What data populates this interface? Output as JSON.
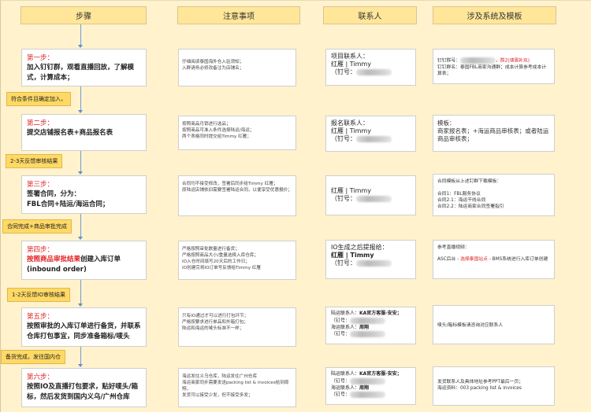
{
  "headers": {
    "steps": "步骤",
    "notes": "注意事项",
    "contacts": "联系人",
    "systems": "涉及系统及模板"
  },
  "transitions": [
    "符合条件且确定加入，",
    "2-3天反馈审核结果",
    "合同完成+商品审批完成",
    "1-2天反馈IO审核结果",
    "备货完成，发往国内仓"
  ],
  "steps": [
    {
      "title": "第一步：",
      "body": "加入钉钉群，观看直播回放，了解模式，计算成本；"
    },
    {
      "title": "第二步：",
      "body": "提交店铺报名表+商品报名表"
    },
    {
      "title": "第三步：",
      "body": "签署合同，分为：",
      "body2": "FBL合同+陆运/海运合同；"
    },
    {
      "title": "第四步：",
      "body_red": "按照商品审批结果",
      "body": "创建入库订单",
      "body2": "(inbound order)"
    },
    {
      "title": "第五步：",
      "body": "按照审批的入库订单进行备货，并联系仓库打包事宜，同步准备箱标/唛头"
    },
    {
      "title": "第六步：",
      "body": "按照IO及直播打包要求，贴好唛头/箱标，然后发货到国内义乌/广州仓库"
    }
  ],
  "notes": [
    [
      "仔细阅读泰国海外仓入驻须知；",
      "入群请务必修改备注为店铺名；"
    ],
    [
      "按照商品月销进行选品；",
      "按照商品可准入条件选择陆运/海运；",
      "两个表格同时提交给Timmy 红雁；"
    ],
    [
      "合同均不接受修改，签署后同步给Timmy 红雁；",
      "原陆运店铺依旧需要签署陆运合同，以便享受优惠报价；"
    ],
    [
      "严格按照审批数量进行备货；",
      "严格按照商品大小/重量选择入库仓库；",
      "IO入仓时间填写20天后的工作日；",
      "IO创建完将IO订单号反馈给Timmy 红雁"
    ],
    [
      "只有IO通过才可以进行打包环节；",
      "严格按要求进行单品和外箱打包；",
      "陆运和海运的唛头标准不一样；"
    ],
    [
      "海运发往义乌仓库，陆运发往广州仓库",
      "海运商家同步需要发送packing list & invoices给到周翔，",
      "发货可以接受少发，但不接受多发；"
    ]
  ],
  "contacts": [
    {
      "label": "项目联系人：",
      "name": "红雁 | Timmy",
      "id_label": "（钉号："
    },
    {
      "label": "报名联系人：",
      "name": "红雁 | Timmy",
      "id_label": "（钉号："
    },
    {
      "label": "",
      "name": "红雁 | Timmy",
      "id_label": "（钉号："
    },
    {
      "label": "IO生成之后提报给：",
      "name": "红雁 | Timmy",
      "id_label": "（钉号："
    },
    {
      "land_label": "陆运联系人：",
      "land_name": "KA官方客服-安安；",
      "id_label": "（钉号：",
      "sea_label": "海运联系人：",
      "sea_name": "周翔"
    },
    {
      "land_label": "陆运联系人：",
      "land_name": "KA官方客服-安安；",
      "id_label": "（钉号：",
      "sea_label": "海运联系人：",
      "sea_name": "周翔"
    }
  ],
  "systems": [
    {
      "l1a": "钉钉群号：",
      "l1b": "，群2(请需补充)",
      "l2": "钉钉群名：泰国FBL商家沟通群；成本计算参考成本计算表；"
    },
    {
      "l1": "模板：",
      "l2": "商家报名表；+海运商品审核表；或者陆运商品审核表；"
    },
    {
      "l1": "合同模板从上述钉群下载模板：",
      "l2": "合同1：FBL服务协议",
      "l3": "合同2.1：海运干线合同",
      "l4": "合同2.2：陆运商家合同签署指引"
    },
    {
      "l1": "参考直播视频：",
      "l2a": "ASC后台 - ",
      "l2red": "选择泰国站点",
      "l2b": " - BMS系统进行入库订单创建"
    },
    {
      "l1": "唛头/箱标模板请咨询对应联系人"
    },
    {
      "l1": "发货联系人及具体地址参考PPT最后一页；",
      "l2": "海运资料：003 packing list & invoices"
    }
  ]
}
